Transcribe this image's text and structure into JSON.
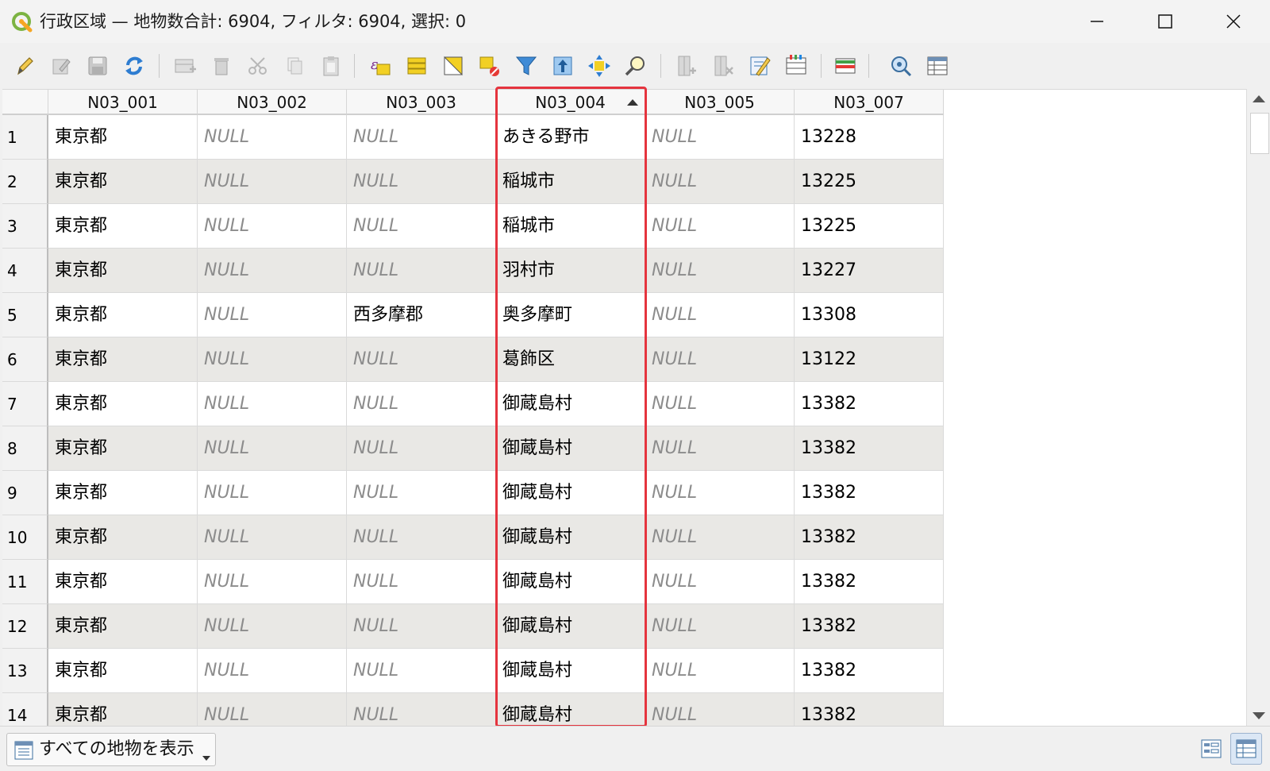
{
  "window": {
    "title": "行政区域 — 地物数合計: 6904, フィルタ: 6904, 選択: 0"
  },
  "toolbar": {
    "icons": [
      "pencil-icon",
      "edit-multiple-icon",
      "save-icon",
      "reload-icon",
      "add-feature-icon",
      "delete-icon",
      "cut-icon",
      "copy-icon",
      "paste-icon",
      "expression-select-icon",
      "select-all-icon",
      "invert-selection-icon",
      "deselect-icon",
      "filter-icon",
      "move-to-top-icon",
      "pan-to-selection-icon",
      "zoom-to-selection-icon",
      "new-field-icon",
      "delete-field-icon",
      "field-calculator-icon",
      "conditional-formatting-icon",
      "actions-icon",
      "dock-icon",
      "table-view-options-icon"
    ]
  },
  "table": {
    "columns": [
      "N03_001",
      "N03_002",
      "N03_003",
      "N03_004",
      "N03_005",
      "N03_007"
    ],
    "sorted_column": "N03_004",
    "rows": [
      [
        "1",
        "東京都",
        "NULL",
        "NULL",
        "あきる野市",
        "NULL",
        "13228"
      ],
      [
        "2",
        "東京都",
        "NULL",
        "NULL",
        "稲城市",
        "NULL",
        "13225"
      ],
      [
        "3",
        "東京都",
        "NULL",
        "NULL",
        "稲城市",
        "NULL",
        "13225"
      ],
      [
        "4",
        "東京都",
        "NULL",
        "NULL",
        "羽村市",
        "NULL",
        "13227"
      ],
      [
        "5",
        "東京都",
        "NULL",
        "西多摩郡",
        "奥多摩町",
        "NULL",
        "13308"
      ],
      [
        "6",
        "東京都",
        "NULL",
        "NULL",
        "葛飾区",
        "NULL",
        "13122"
      ],
      [
        "7",
        "東京都",
        "NULL",
        "NULL",
        "御蔵島村",
        "NULL",
        "13382"
      ],
      [
        "8",
        "東京都",
        "NULL",
        "NULL",
        "御蔵島村",
        "NULL",
        "13382"
      ],
      [
        "9",
        "東京都",
        "NULL",
        "NULL",
        "御蔵島村",
        "NULL",
        "13382"
      ],
      [
        "10",
        "東京都",
        "NULL",
        "NULL",
        "御蔵島村",
        "NULL",
        "13382"
      ],
      [
        "11",
        "東京都",
        "NULL",
        "NULL",
        "御蔵島村",
        "NULL",
        "13382"
      ],
      [
        "12",
        "東京都",
        "NULL",
        "NULL",
        "御蔵島村",
        "NULL",
        "13382"
      ],
      [
        "13",
        "東京都",
        "NULL",
        "NULL",
        "御蔵島村",
        "NULL",
        "13382"
      ],
      [
        "14",
        "東京都",
        "NULL",
        "NULL",
        "御蔵島村",
        "NULL",
        "13382"
      ]
    ]
  },
  "bottombar": {
    "filter_label": "すべての地物を表示"
  },
  "colors": {
    "highlight": "#e5343e",
    "alt_row": "#e9e8e5",
    "null_text": "#8c8c8c"
  }
}
